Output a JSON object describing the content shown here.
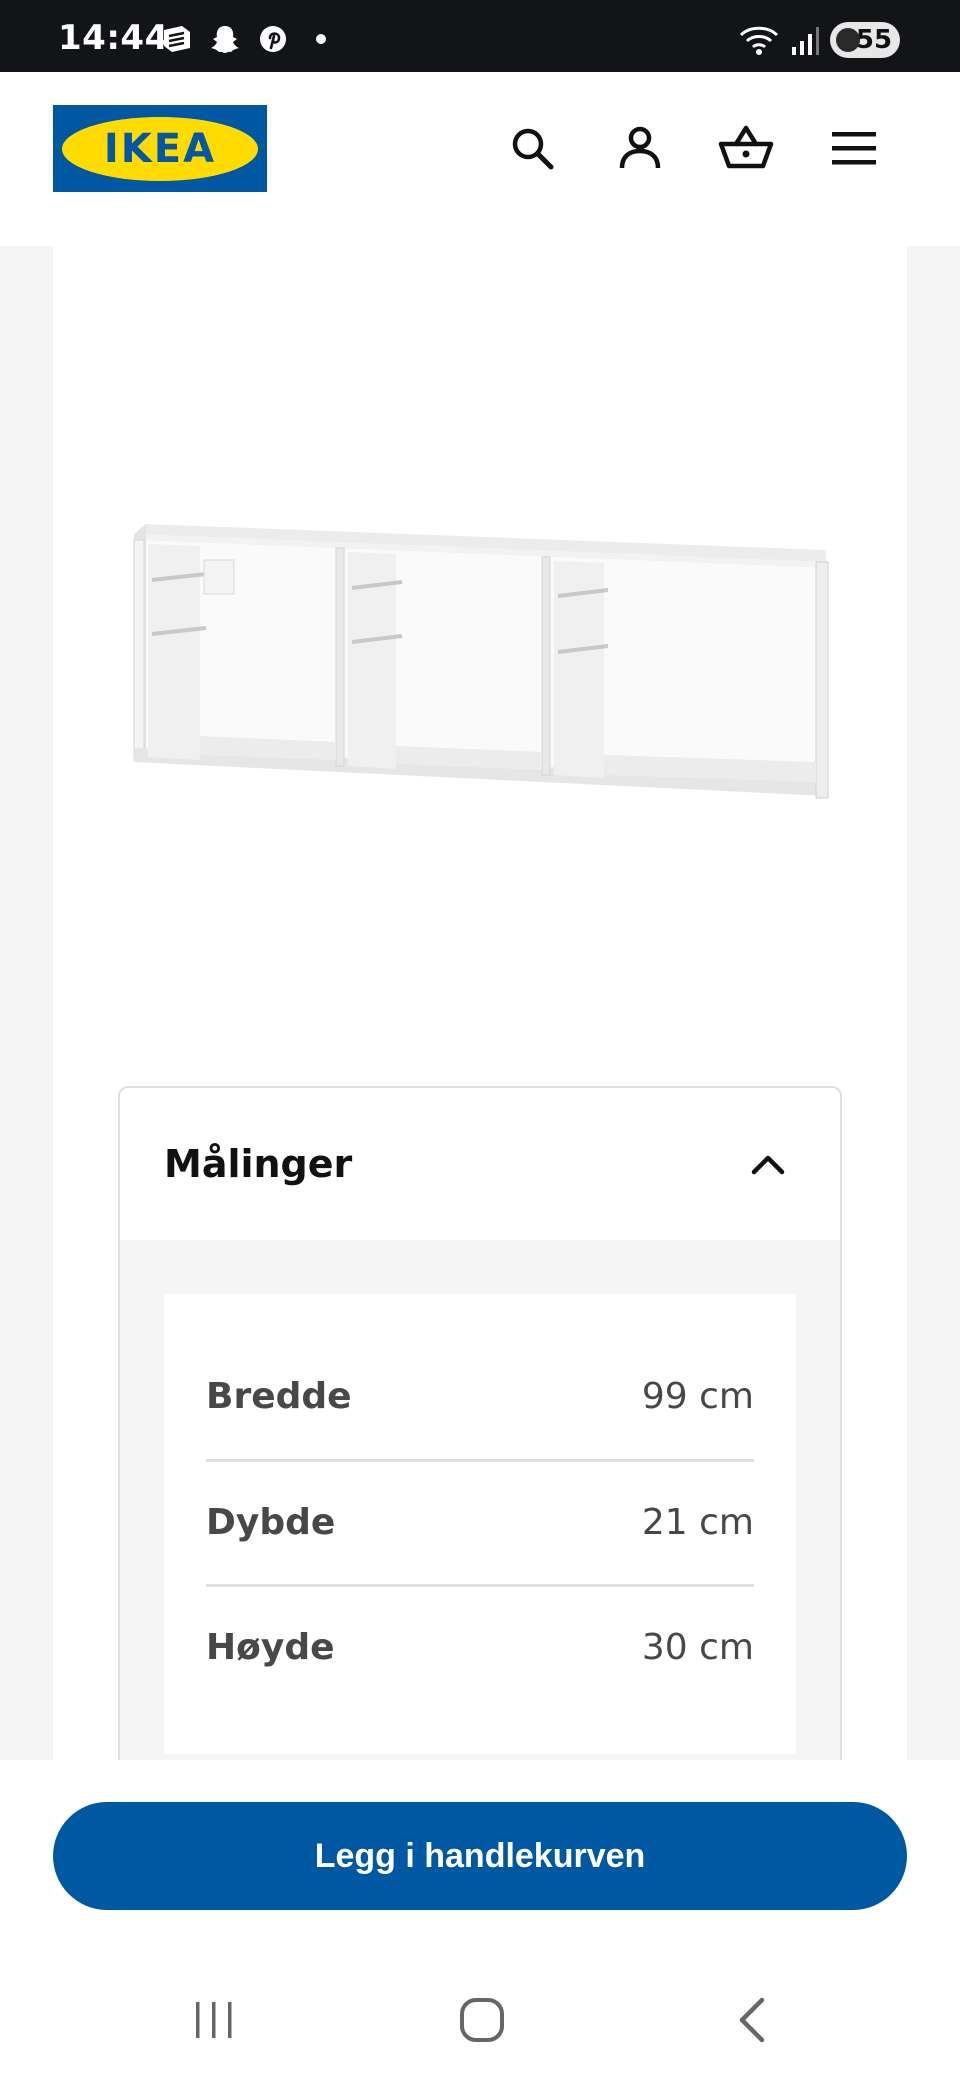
{
  "status_bar": {
    "time": "14:44",
    "battery": "55",
    "icons": [
      "news-icon",
      "snapchat-icon",
      "pinterest-icon",
      "notification-dot",
      "wifi-icon",
      "signal-icon",
      "battery-icon"
    ]
  },
  "header": {
    "logo_text": "IKEA",
    "icons": [
      "search-icon",
      "account-icon",
      "cart-icon",
      "menu-icon"
    ]
  },
  "dimensions": {
    "title": "Målinger",
    "rows": [
      {
        "label": "Bredde",
        "value": "99 cm"
      },
      {
        "label": "Dybde",
        "value": "21 cm"
      },
      {
        "label": "Høyde",
        "value": "30 cm"
      }
    ]
  },
  "actions": {
    "add_to_cart": "Legg i handlekurven"
  },
  "navbar": {
    "icons": [
      "recent-apps-icon",
      "home-icon",
      "back-icon"
    ]
  },
  "colors": {
    "brand_blue": "#0058a3",
    "brand_yellow": "#ffdb00",
    "status_bar_bg": "#121418"
  }
}
